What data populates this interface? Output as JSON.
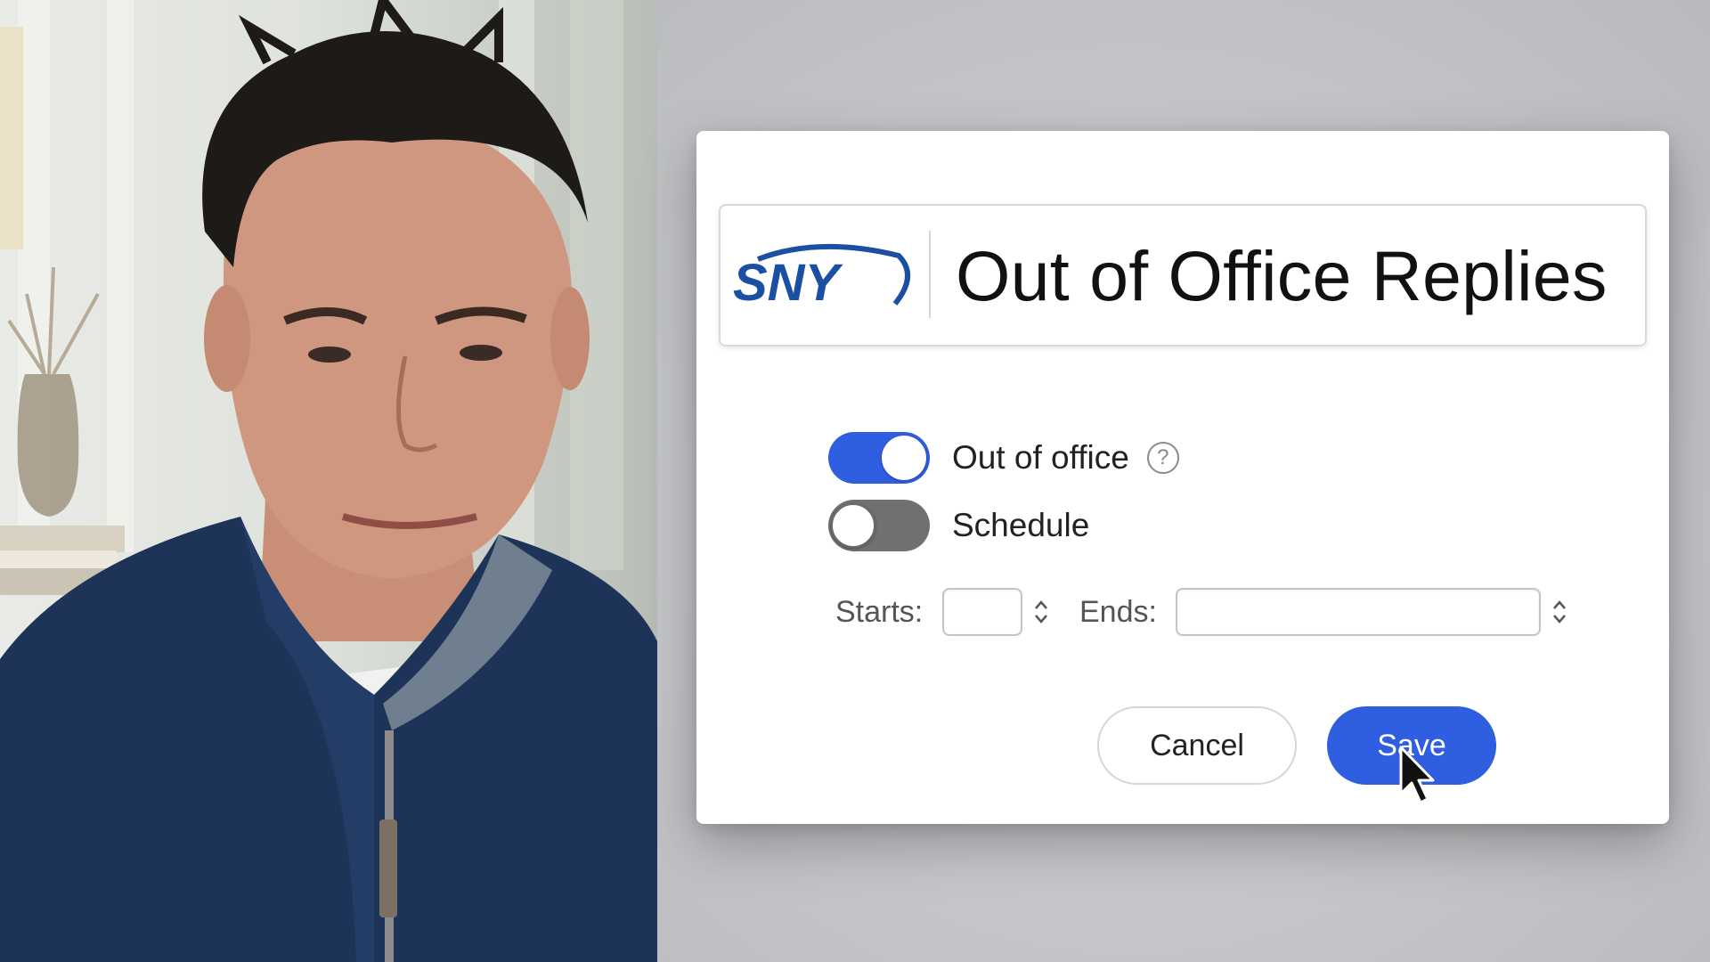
{
  "video": {
    "description_icon": "person-webcam-feed"
  },
  "dialog": {
    "logo_text": "SNY",
    "title": "Out of Office Replies",
    "out_of_office": {
      "label": "Out of office",
      "on": true
    },
    "help_icon": "?",
    "schedule": {
      "label": "Schedule",
      "on": false
    },
    "starts_label": "Starts:",
    "starts_value": "",
    "ends_label": "Ends:",
    "ends_value": "",
    "cancel_label": "Cancel",
    "save_label": "Save"
  },
  "colors": {
    "accent": "#2f5fe0",
    "logo_blue": "#1b4fa3",
    "toggle_off": "#707070",
    "background": "#c4c5c8"
  }
}
